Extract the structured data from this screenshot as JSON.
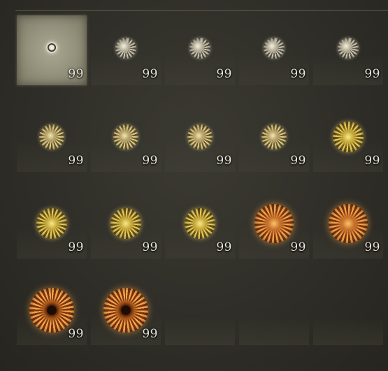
{
  "inventory": {
    "slots": [
      {
        "count": "99",
        "icon": "somber-smithing-stone-icon",
        "variant": "somber-selected",
        "selected": true
      },
      {
        "count": "99",
        "icon": "smithing-stone-icon",
        "variant": "pale",
        "selected": false
      },
      {
        "count": "99",
        "icon": "smithing-stone-icon",
        "variant": "pale",
        "selected": false
      },
      {
        "count": "99",
        "icon": "smithing-stone-icon",
        "variant": "pale",
        "selected": false
      },
      {
        "count": "99",
        "icon": "smithing-stone-icon",
        "variant": "pale",
        "selected": false
      },
      {
        "count": "99",
        "icon": "smithing-stone-icon",
        "variant": "yellowish",
        "selected": false
      },
      {
        "count": "99",
        "icon": "smithing-stone-icon",
        "variant": "yellowish",
        "selected": false
      },
      {
        "count": "99",
        "icon": "smithing-stone-icon",
        "variant": "yellowish",
        "selected": false
      },
      {
        "count": "99",
        "icon": "smithing-stone-icon",
        "variant": "yellowish",
        "selected": false
      },
      {
        "count": "99",
        "icon": "smithing-stone-icon",
        "variant": "gold",
        "selected": false
      },
      {
        "count": "99",
        "icon": "smithing-stone-icon",
        "variant": "gold",
        "selected": false
      },
      {
        "count": "99",
        "icon": "smithing-stone-icon",
        "variant": "gold",
        "selected": false
      },
      {
        "count": "99",
        "icon": "smithing-stone-icon",
        "variant": "gold",
        "selected": false
      },
      {
        "count": "99",
        "icon": "smithing-stone-icon",
        "variant": "orange",
        "selected": false
      },
      {
        "count": "99",
        "icon": "smithing-stone-icon",
        "variant": "orange",
        "selected": false
      },
      {
        "count": "99",
        "icon": "ancient-dragon-smithing-stone-icon",
        "variant": "eye",
        "selected": false
      },
      {
        "count": "99",
        "icon": "ancient-dragon-smithing-stone-icon",
        "variant": "eye",
        "selected": false
      }
    ],
    "empty_slots": 3
  },
  "colors": {
    "background": "#2f2e28",
    "selected_slot": "#9a9782",
    "count_text": "#e6e4da"
  }
}
